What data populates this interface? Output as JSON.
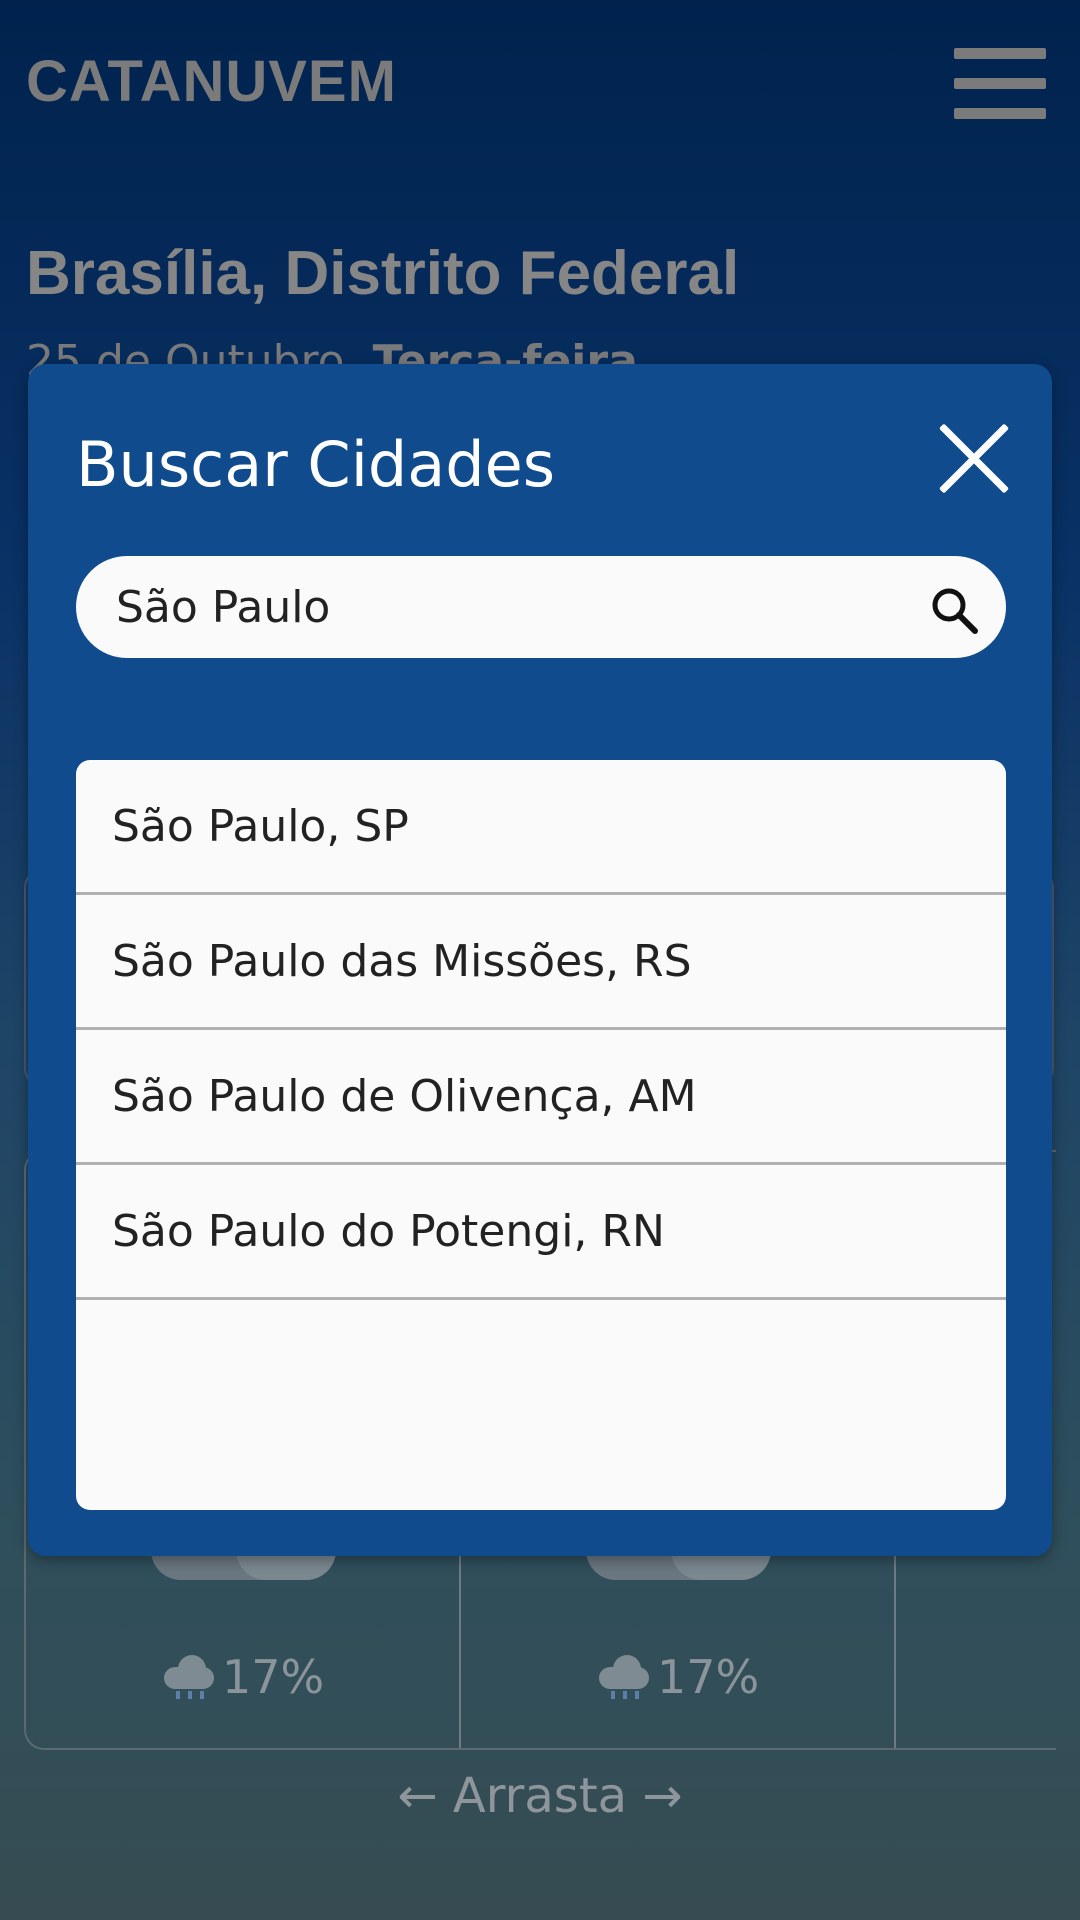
{
  "app": {
    "brand": "CATANUVEM",
    "location": "Brasília, Distrito Federal",
    "date_prefix": "25 de Outubro, ",
    "weekday": "Terça-feira",
    "forecast": [
      {
        "rain": "17%"
      },
      {
        "rain": "17%"
      }
    ],
    "drag_hint": "← Arrasta →"
  },
  "modal": {
    "title": "Buscar Cidades",
    "search": {
      "value": "São Paulo"
    },
    "results": [
      "São Paulo, SP",
      "São Paulo das Missões, RS",
      "São Paulo de Olivença, AM",
      "São Paulo do Potengi, RN"
    ]
  },
  "icons": {
    "close": "close-icon",
    "search": "search-icon",
    "menu": "hamburger-menu-icon",
    "rain": "rain-cloud-icon"
  },
  "colors": {
    "modal_bg": "#104b8d",
    "input_bg": "#fafafa"
  }
}
